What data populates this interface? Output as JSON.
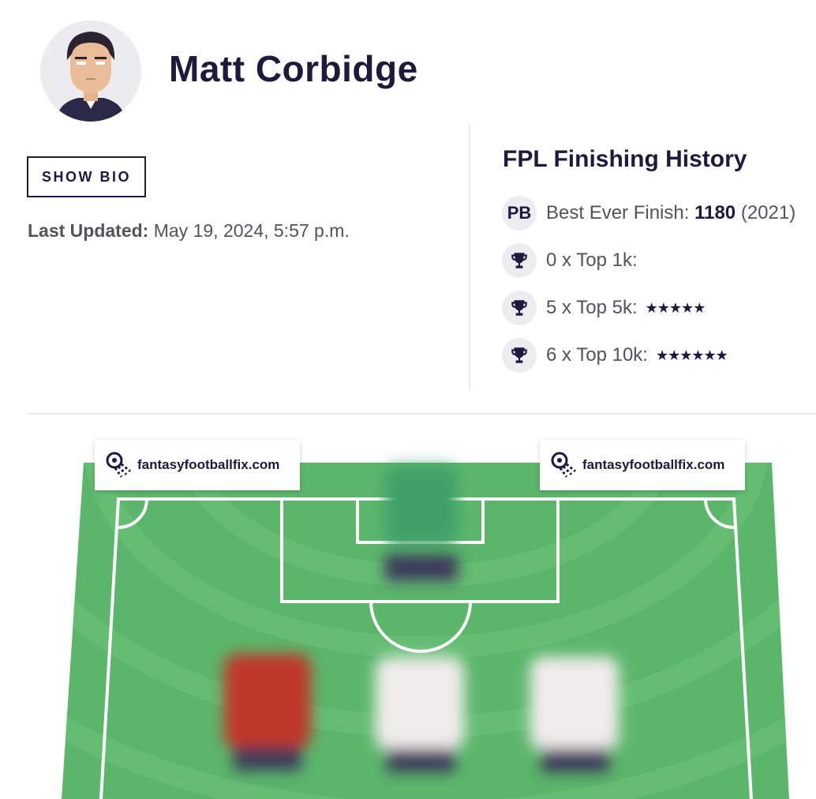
{
  "profile": {
    "name": "Matt Corbidge",
    "bio_button": "SHOW BIO",
    "last_updated_label": "Last Updated:",
    "last_updated_value": "May 19, 2024, 5:57 p.m."
  },
  "history": {
    "title": "FPL Finishing History",
    "best_badge": "PB",
    "best_label": "Best Ever Finish:",
    "best_rank": "1180",
    "best_year": "(2021)",
    "rows": [
      {
        "text": "0 x Top 1k:",
        "stars": ""
      },
      {
        "text": "5 x Top 5k:",
        "stars": "★★★★★"
      },
      {
        "text": "6 x Top 10k:",
        "stars": "★★★★★★"
      }
    ]
  },
  "watermark": {
    "text": "fantasyfootballfix.com"
  },
  "icons": {
    "avatar": "manager-avatar",
    "trophy": "trophy-icon",
    "logo": "football-logo-icon"
  },
  "colors": {
    "primary": "#1f1a3d",
    "pitch": "#5bb66b",
    "pitch_light": "#64bd73",
    "line": "#ffffff"
  }
}
